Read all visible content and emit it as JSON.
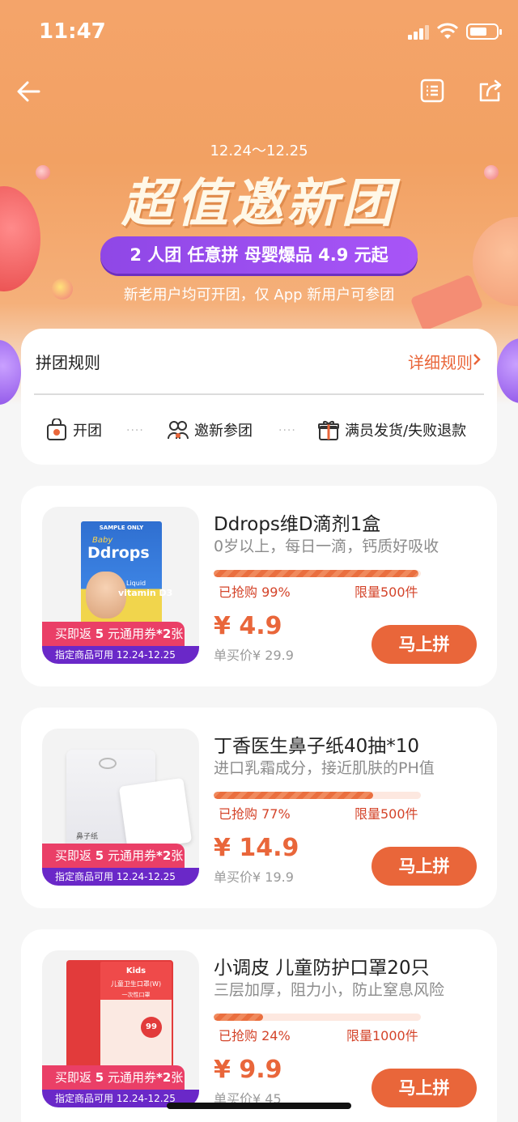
{
  "status_bar": {
    "time": "11:47"
  },
  "hero": {
    "date_range": "12.24～12.25",
    "title": "超值邀新团",
    "banner": "2 人团 任意拼   母婴爆品 4.9 元起",
    "subtitle": "新老用户均可开团，仅 App 新用户可参团"
  },
  "rules": {
    "title": "拼团规则",
    "detail_link": "详细规则",
    "steps": [
      "开团",
      "邀新参团",
      "满员发货/失败退款"
    ],
    "dots": "····"
  },
  "products": [
    {
      "name": "Ddrops维D滴剂1盒",
      "desc": "0岁以上，每日一滴，钙质好吸收",
      "sold_label": "已抢购 99%",
      "progress": 0.99,
      "limit": "限量500件",
      "price": "¥ 4.9",
      "original": "单买价¥ 29.9",
      "button": "马上拼",
      "coupon_pre": "买即返 ",
      "coupon_amount": "5",
      "coupon_mid": " 元通用券",
      "coupon_count": "*2",
      "coupon_post": "张",
      "coupon_note": "指定商品可用   12.24-12.25",
      "image_text": {
        "top": "SAMPLE ONLY",
        "brand_small": "Baby",
        "brand": "Ddrops",
        "liquid": "Liquid",
        "vitamin": "vitamin D3"
      }
    },
    {
      "name": "丁香医生鼻子纸40抽*10",
      "desc": "进口乳霜成分，接近肌肤的PH值",
      "sold_label": "已抢购 77%",
      "progress": 0.77,
      "limit": "限量500件",
      "price": "¥ 14.9",
      "original": "单买价¥ 19.9",
      "button": "马上拼",
      "coupon_pre": "买即返 ",
      "coupon_amount": "5",
      "coupon_mid": " 元通用券",
      "coupon_count": "*2",
      "coupon_post": "张",
      "coupon_note": "指定商品可用   12.24-12.25",
      "image_text": {
        "label": "鼻子纸"
      }
    },
    {
      "name": "小调皮 儿童防护口罩20只",
      "desc": "三层加厚，阻力小，防止窒息风险",
      "sold_label": "已抢购 24%",
      "progress": 0.24,
      "limit": "限量1000件",
      "price": "¥ 9.9",
      "original": "单买价¥ 45",
      "button": "马上拼",
      "coupon_pre": "买即返 ",
      "coupon_amount": "5",
      "coupon_mid": " 元通用券",
      "coupon_count": "*2",
      "coupon_post": "张",
      "coupon_note": "指定商品可用   12.24-12.25",
      "image_text": {
        "brand": "Kids",
        "label": "儿童卫生口罩(W)",
        "sub": "一次性口罩",
        "badge": "99"
      }
    }
  ],
  "colors": {
    "accent": "#e9663a",
    "coupon_pink": "#ea3f67",
    "coupon_purple": "#6a28c8",
    "hero": "#f4a46a"
  }
}
